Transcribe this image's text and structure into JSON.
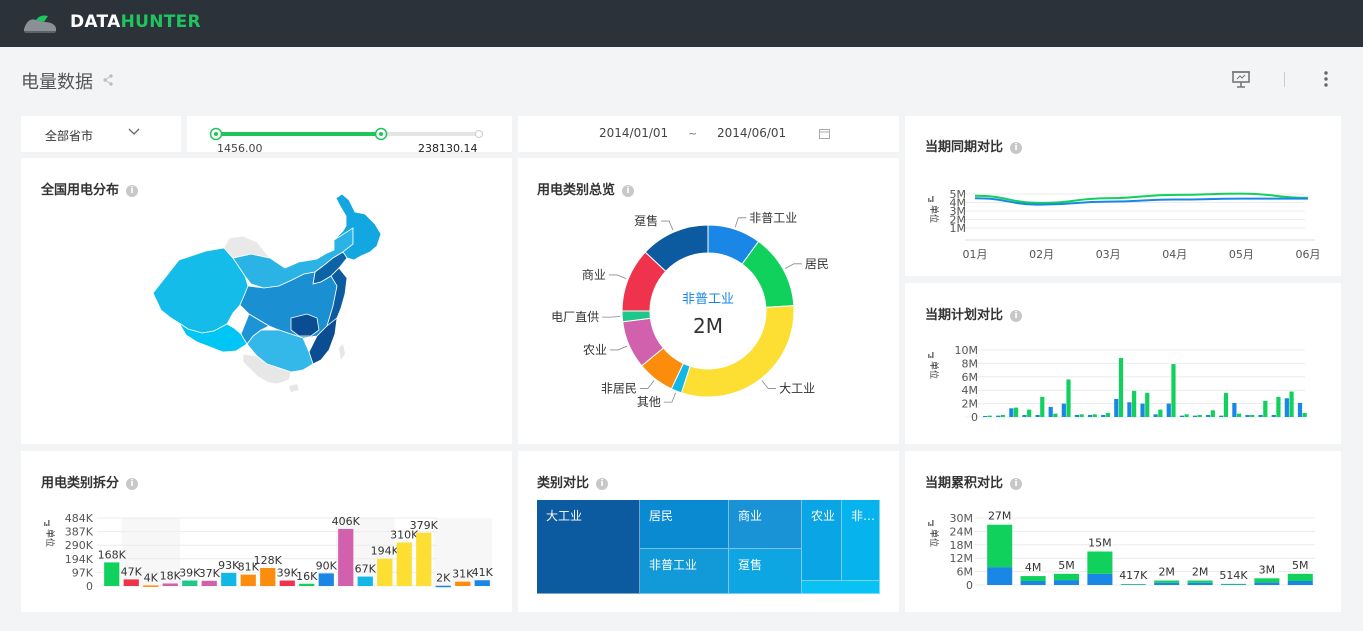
{
  "brand": {
    "part1": "DATA",
    "part2": "HUNTER"
  },
  "page": {
    "title": "电量数据"
  },
  "icons": {
    "logo": "shoe-logo-icon",
    "share": "share-icon",
    "present": "presentation-icon",
    "more": "more-vertical-icon",
    "info": "info-icon",
    "dropdown": "chevron-down-icon",
    "calendar": "calendar-icon",
    "legend": "legend-icon"
  },
  "filters": {
    "province": "全部省市",
    "range_min": "1456.00",
    "range_max": "238130.14",
    "range_min_frac": 0,
    "range_low_frac": 0.0,
    "range_high_frac": 0.6276,
    "date_start": "2014/01/01",
    "date_sep": "~",
    "date_end": "2014/06/01"
  },
  "colors": {
    "green": "#0fd15c",
    "blue": "#1a87e6",
    "accent": "#1fc45c"
  },
  "cards": {
    "map": {
      "title": "全国用电分布"
    },
    "donut": {
      "title": "用电类别总览"
    },
    "yoy": {
      "title": "当期同期对比"
    },
    "plan": {
      "title": "当期计划对比"
    },
    "split": {
      "title": "用电类别拆分"
    },
    "compare": {
      "title": "类别对比"
    },
    "cumulative": {
      "title": "当期累积对比"
    }
  },
  "chart_data": [
    {
      "id": "donut",
      "type": "pie",
      "center_label": "非普工业",
      "center_value": "2M",
      "categories": [
        "非普工业",
        "居民",
        "大工业",
        "其他",
        "非居民",
        "农业",
        "电厂直供",
        "商业",
        "趸售"
      ],
      "values": [
        10,
        14,
        31,
        2,
        7,
        9,
        2,
        12,
        13
      ],
      "colors": [
        "#1a87e6",
        "#0fd15c",
        "#fdde32",
        "#12b7e6",
        "#fc8c0c",
        "#d161ad",
        "#1dc88a",
        "#f0334c",
        "#0c5aa0"
      ]
    },
    {
      "id": "yoy",
      "type": "line",
      "x": [
        "01月",
        "02月",
        "03月",
        "04月",
        "05月",
        "06月"
      ],
      "yticks": [
        "5M",
        "4M",
        "3M",
        "2M",
        "1M"
      ],
      "ylim": [
        0,
        6
      ],
      "ylabel": "单位",
      "series": [
        {
          "color": "#0fd15c",
          "values": [
            4.8,
            3.95,
            4.5,
            4.9,
            5.05,
            4.55
          ]
        },
        {
          "color": "#1a87e6",
          "values": [
            4.5,
            3.75,
            4.1,
            4.35,
            4.45,
            4.45
          ]
        }
      ]
    },
    {
      "id": "plan",
      "type": "bar",
      "yticks": [
        "10M",
        "8M",
        "6M",
        "4M",
        "2M",
        "0"
      ],
      "ylim": [
        0,
        10
      ],
      "ylabel": "单位",
      "series": [
        {
          "color": "#1a87e6",
          "values": [
            0.15,
            0.2,
            1.3,
            0.3,
            0.3,
            1.5,
            2.0,
            0.3,
            0.3,
            0.3,
            2.7,
            2.2,
            2.0,
            0.4,
            2.0,
            0.2,
            0.2,
            0.3,
            0.2,
            2.1,
            0.3,
            0.3,
            0.3,
            2.8,
            2.1
          ]
        },
        {
          "color": "#0fd15c",
          "values": [
            0.2,
            0.3,
            1.4,
            1.1,
            3.0,
            0.5,
            5.6,
            0.4,
            0.4,
            0.6,
            8.8,
            3.9,
            3.6,
            1.1,
            7.9,
            0.4,
            0.3,
            1.0,
            3.6,
            0.5,
            0.3,
            2.4,
            3.0,
            3.8,
            0.6
          ]
        }
      ]
    },
    {
      "id": "split",
      "type": "bar",
      "yticks": [
        "484K",
        "387K",
        "290K",
        "194K",
        "97K",
        "0"
      ],
      "ylim": [
        0,
        484
      ],
      "ylabel": "单位",
      "labels": [
        "168K",
        "47K",
        "4K",
        "18K",
        "39K",
        "37K",
        "93K",
        "81K",
        "128K",
        "39K",
        "16K",
        "90K",
        "406K",
        "67K",
        "194K",
        "310K",
        "379K",
        "2K",
        "31K",
        "41K"
      ],
      "values": [
        168,
        47,
        4,
        18,
        39,
        37,
        93,
        81,
        128,
        39,
        16,
        90,
        406,
        67,
        194,
        310,
        379,
        2,
        31,
        41
      ],
      "colors": [
        "#0fd15c",
        "#f0334c",
        "#fc8c0c",
        "#d161ad",
        "#1dc88a",
        "#d161ad",
        "#12b7e6",
        "#fc8c0c",
        "#fc8c0c",
        "#f0334c",
        "#0fd15c",
        "#1a87e6",
        "#d161ad",
        "#12b7e6",
        "#fdde32",
        "#fdde32",
        "#fdde32",
        "#1a87e6",
        "#fc8c0c",
        "#1a87e6"
      ]
    },
    {
      "id": "cumulative",
      "type": "bar",
      "stacked": true,
      "yticks": [
        "30M",
        "24M",
        "18M",
        "12M",
        "6M",
        "0"
      ],
      "ylim": [
        0,
        30
      ],
      "ylabel": "单位",
      "labels": [
        "27M",
        "4M",
        "5M",
        "15M",
        "417K",
        "2M",
        "2M",
        "514K",
        "3M",
        "5M"
      ],
      "series": [
        {
          "color": "#1a87e6",
          "values": [
            8.0,
            1.8,
            2.2,
            5.0,
            0.2,
            1.0,
            1.0,
            0.25,
            1.2,
            1.8
          ]
        },
        {
          "color": "#0fd15c",
          "values": [
            19.0,
            2.2,
            2.8,
            10.0,
            0.2,
            1.0,
            1.0,
            0.26,
            1.8,
            3.2
          ]
        }
      ]
    },
    {
      "id": "compare",
      "type": "treemap",
      "categories": [
        "大工业",
        "居民",
        "非普工业",
        "商业",
        "趸售",
        "农业",
        "非…"
      ]
    }
  ]
}
